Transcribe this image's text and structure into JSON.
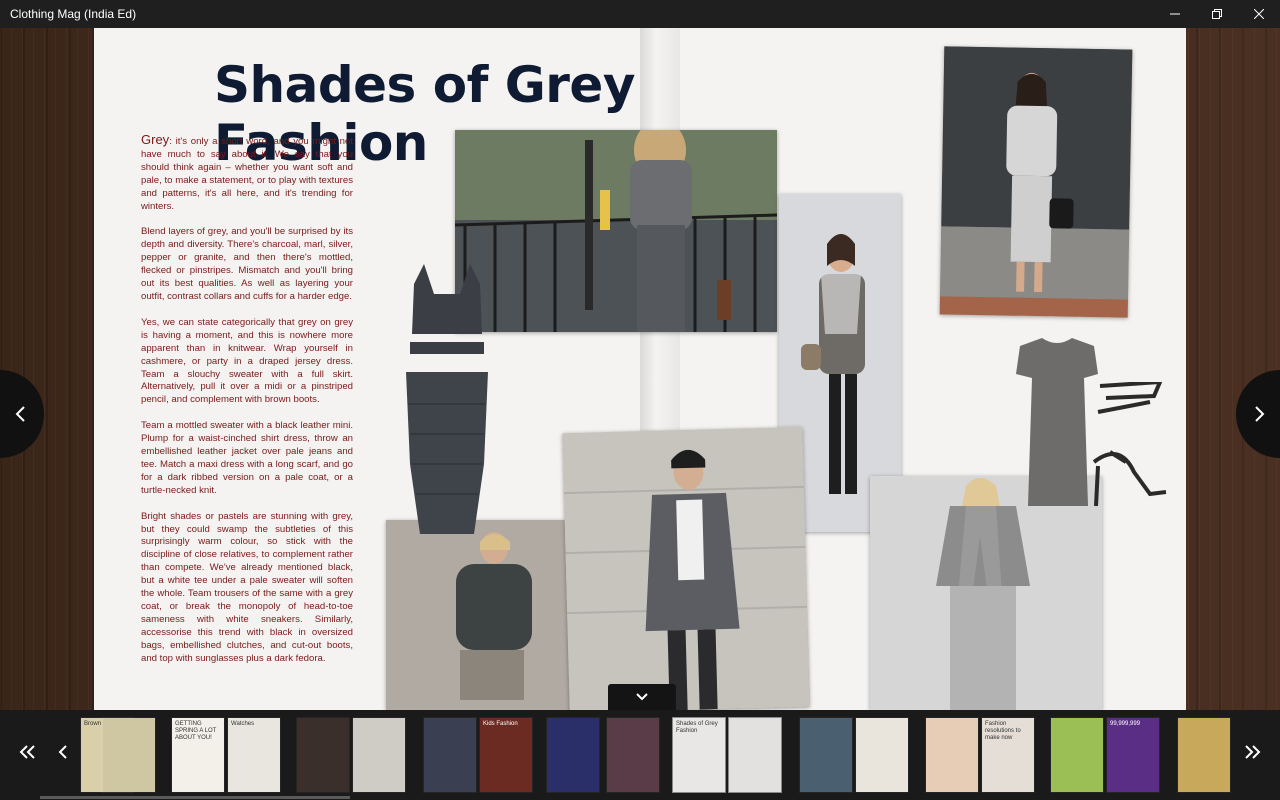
{
  "window": {
    "title": "Clothing Mag (India Ed)",
    "minimize_icon": "minimize-icon",
    "restore_icon": "restore-icon",
    "close_icon": "close-icon"
  },
  "article": {
    "headline": "Shades of Grey Fashion",
    "lead_word": "Grey",
    "paragraphs": [
      ": it's only a short word, and you might not have much to say about it. We say that you should think again – whether you want soft and pale, to make a statement, or to play with textures and patterns, it's all here, and it's trending for winters.",
      "Blend layers of grey, and you'll be surprised by its depth and diversity. There's charcoal, marl, silver, pepper or granite, and then there's mottled, flecked or pinstripes. Mismatch and you'll bring out its best qualities. As well as layering your outfit, contrast collars and cuffs for a harder edge.",
      "Yes, we can state categorically that grey on grey is having a moment, and this is nowhere more apparent than in knitwear. Wrap yourself in cashmere, or party in a draped jersey dress. Team a slouchy sweater with a full skirt. Alternatively, pull it over a midi or a pinstriped pencil, and complement with brown boots.",
      "Team a mottled sweater with a black leather mini. Plump for a waist-cinched shirt dress, throw an embellished leather jacket over pale jeans and tee. Match a maxi dress with a long scarf, and go for a dark ribbed version on a pale coat, or a turtle-necked knit.",
      "Bright shades or pastels are stunning with grey, but they could swamp the subtleties of this surprisingly warm colour, so stick with the discipline of close relatives, to complement rather than compete. We've already mentioned black, but a white tee under a pale sweater will soften the whole. Team trousers of the same with a grey coat, or break the monopoly of head-to-toe sameness with white sneakers. Similarly, accessorise this trend with black in oversized bags, embellished clutches, and cut-out boots, and top with sunglasses plus a dark fedora."
    ]
  },
  "navigation": {
    "prev_page_icon": "chevron-left-icon",
    "next_page_icon": "chevron-right-icon",
    "collapse_icon": "chevron-down-icon",
    "strip_first_icon": "double-chevron-left-icon",
    "strip_prev_icon": "chevron-left-icon",
    "strip_next_icon": "chevron-right-icon",
    "strip_last_icon": "double-chevron-right-icon"
  },
  "thumbnails": [
    {
      "label": "Brown Georgette",
      "color": "#d9cfa8"
    },
    {
      "label": "",
      "color": "#cfc7a1"
    },
    {
      "label": "GETTING SPRING A LOT ABOUT YOU!",
      "color": "#f3efe9"
    },
    {
      "label": "Watches",
      "color": "#e9e6e0"
    },
    {
      "label": "",
      "color": "#3a2f2a"
    },
    {
      "label": "",
      "color": "#cfccc6"
    },
    {
      "label": "",
      "color": "#3b3f52"
    },
    {
      "label": "Kids Fashion",
      "color": "#6b2a22"
    },
    {
      "label": "",
      "color": "#2a2f6a"
    },
    {
      "label": "",
      "color": "#5a3b48"
    },
    {
      "label": "Shades of Grey Fashion",
      "color": "#e8e7e5"
    },
    {
      "label": "",
      "color": "#e2e1df"
    },
    {
      "label": "",
      "color": "#4a5f6f"
    },
    {
      "label": "",
      "color": "#e9e4dc"
    },
    {
      "label": "",
      "color": "#e7cdb6"
    },
    {
      "label": "Fashion resolutions to make now",
      "color": "#e4ded6"
    },
    {
      "label": "",
      "color": "#9cbf55"
    },
    {
      "label": "99,999,999",
      "color": "#5b2e86"
    },
    {
      "label": "",
      "color": "#c8a85a"
    }
  ]
}
